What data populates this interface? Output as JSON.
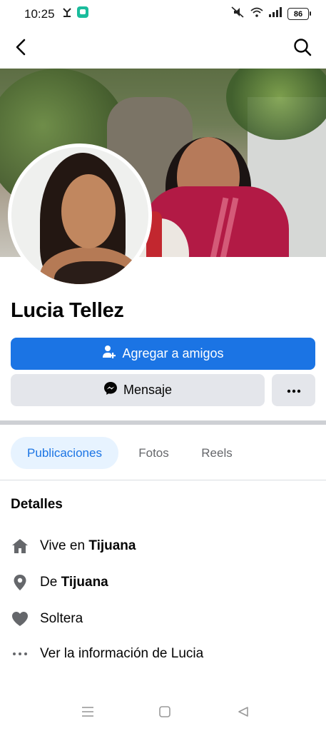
{
  "status_bar": {
    "time": "10:25",
    "battery": "86"
  },
  "profile": {
    "name": "Lucia Tellez"
  },
  "actions": {
    "add_friend_label": "Agregar a amigos",
    "message_label": "Mensaje"
  },
  "tabs": [
    {
      "label": "Publicaciones",
      "active": true
    },
    {
      "label": "Fotos",
      "active": false
    },
    {
      "label": "Reels",
      "active": false
    }
  ],
  "details": {
    "title": "Detalles",
    "lives_prefix": "Vive en ",
    "lives_city": "Tijuana",
    "from_prefix": "De ",
    "from_city": "Tijuana",
    "relationship": "Soltera",
    "see_info": "Ver la información de Lucia"
  },
  "colors": {
    "accent": "#1b74e4",
    "secondary_button": "#e4e6eb",
    "tab_active_bg": "#e7f3ff"
  },
  "icons": [
    "back-icon",
    "search-icon",
    "person-add-icon",
    "messenger-icon",
    "more-icon",
    "home-icon",
    "location-pin-icon",
    "heart-icon",
    "dots-icon"
  ]
}
